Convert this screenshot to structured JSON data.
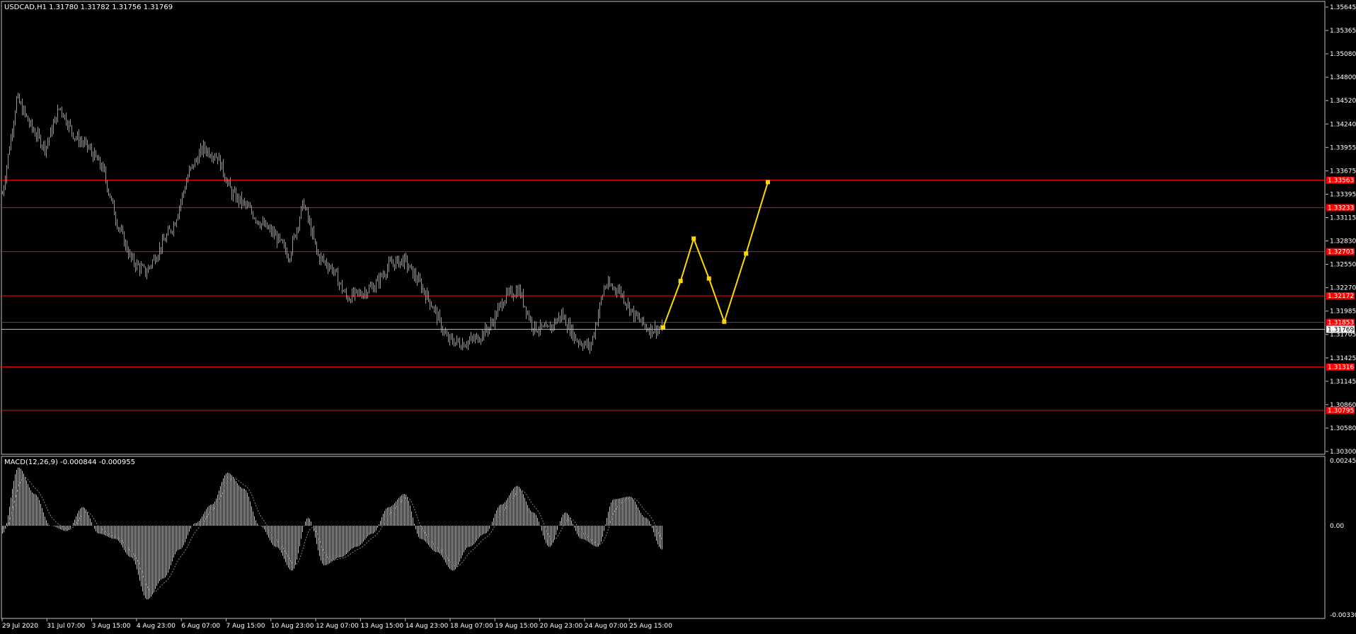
{
  "window": {
    "symbol_header": "USDCAD,H1  1.31780 1.31782 1.31756 1.31769"
  },
  "macd": {
    "header": "MACD(12,26,9) -0.000844 -0.000955",
    "scale_labels": [
      "0.002457",
      "0.00",
      "-0.003304"
    ]
  },
  "price_axis": {
    "labels": [
      "1.35645",
      "1.35365",
      "1.35080",
      "1.34800",
      "1.34520",
      "1.34240",
      "1.33955",
      "1.33675",
      "1.33395",
      "1.33115",
      "1.32830",
      "1.32550",
      "1.32270",
      "1.31985",
      "1.31705",
      "1.31425",
      "1.31145",
      "1.30860",
      "1.30580",
      "1.30300"
    ],
    "current_price": "1.31769"
  },
  "levels": [
    {
      "value": 1.33563,
      "label": "1.33563",
      "color": "#ff0000"
    },
    {
      "value": 1.33233,
      "label": "1.33233",
      "color": "#ff0000"
    },
    {
      "value": 1.32703,
      "label": "1.32703",
      "color": "#ff0000"
    },
    {
      "value": 1.32172,
      "label": "1.32172",
      "color": "#ff0000"
    },
    {
      "value": 1.31853,
      "label": "1.31853",
      "color": "#ff0000"
    },
    {
      "value": 1.31316,
      "label": "1.31316",
      "color": "#ff0000"
    },
    {
      "value": 1.30795,
      "label": "1.30795",
      "color": "#ff0000"
    }
  ],
  "time_axis": {
    "labels": [
      "29 Jul 2020",
      "31 Jul 07:00",
      "3 Aug 15:00",
      "4 Aug 23:00",
      "6 Aug 07:00",
      "7 Aug 15:00",
      "10 Aug 23:00",
      "12 Aug 07:00",
      "13 Aug 15:00",
      "14 Aug 23:00",
      "18 Aug 07:00",
      "19 Aug 15:00",
      "20 Aug 23:00",
      "24 Aug 07:00",
      "25 Aug 15:00"
    ]
  },
  "colors": {
    "candle": "#00ff00",
    "level": "#ff0000",
    "projection": "#ffd700",
    "macd": "#c0c0c0",
    "frame": "#c0c0c0",
    "current_price_line": "#c0c0c0"
  },
  "chart_data": {
    "type": "line",
    "symbol": "USDCAD",
    "timeframe": "H1",
    "ylim": [
      1.303,
      1.35645
    ],
    "x": [
      "29 Jul 2020",
      "31 Jul 07:00",
      "3 Aug 15:00",
      "4 Aug 23:00",
      "6 Aug 07:00",
      "7 Aug 15:00",
      "10 Aug 23:00",
      "12 Aug 07:00",
      "13 Aug 15:00",
      "14 Aug 23:00",
      "18 Aug 07:00",
      "19 Aug 15:00",
      "20 Aug 23:00",
      "24 Aug 07:00",
      "25 Aug 15:00"
    ],
    "price_anchors": [
      1.334,
      1.3455,
      1.342,
      1.3395,
      1.3445,
      1.341,
      1.3395,
      1.337,
      1.3305,
      1.326,
      1.3245,
      1.3275,
      1.3305,
      1.3365,
      1.3395,
      1.3385,
      1.334,
      1.3325,
      1.3305,
      1.329,
      1.3265,
      1.333,
      1.3265,
      1.325,
      1.3215,
      1.322,
      1.323,
      1.3255,
      1.326,
      1.3235,
      1.3205,
      1.3165,
      1.316,
      1.3165,
      1.318,
      1.3215,
      1.3225,
      1.318,
      1.3175,
      1.3195,
      1.3165,
      1.3155,
      1.323,
      1.3225,
      1.3195,
      1.3178,
      1.3177
    ],
    "projection_points": [
      {
        "x": "25 Aug 15:00 +2h",
        "y": 1.3179
      },
      {
        "x": "+8h",
        "y": 1.3235
      },
      {
        "x": "+14h",
        "y": 1.3286
      },
      {
        "x": "+21h",
        "y": 1.3238
      },
      {
        "x": "+28h",
        "y": 1.3186
      },
      {
        "x": "+38h",
        "y": 1.3268
      },
      {
        "x": "+48h",
        "y": 1.3354
      }
    ],
    "macd_ylim": [
      -0.003304,
      0.002457
    ],
    "macd_anchors": [
      -0.0003,
      0.0022,
      0.0012,
      0.0,
      -0.0002,
      0.0007,
      -0.0003,
      -0.0005,
      -0.0012,
      -0.0028,
      -0.002,
      -0.0009,
      0.0001,
      0.0008,
      0.002,
      0.0014,
      0.0,
      -0.0008,
      -0.0017,
      0.0003,
      -0.0015,
      -0.0012,
      -0.0008,
      -0.0003,
      0.0007,
      0.0012,
      -0.0005,
      -0.001,
      -0.0017,
      -0.0008,
      -0.0003,
      0.0008,
      0.0015,
      0.0005,
      -0.0008,
      0.0005,
      -0.0005,
      -0.0008,
      0.001,
      0.0011,
      0.0003,
      -0.0009
    ]
  }
}
